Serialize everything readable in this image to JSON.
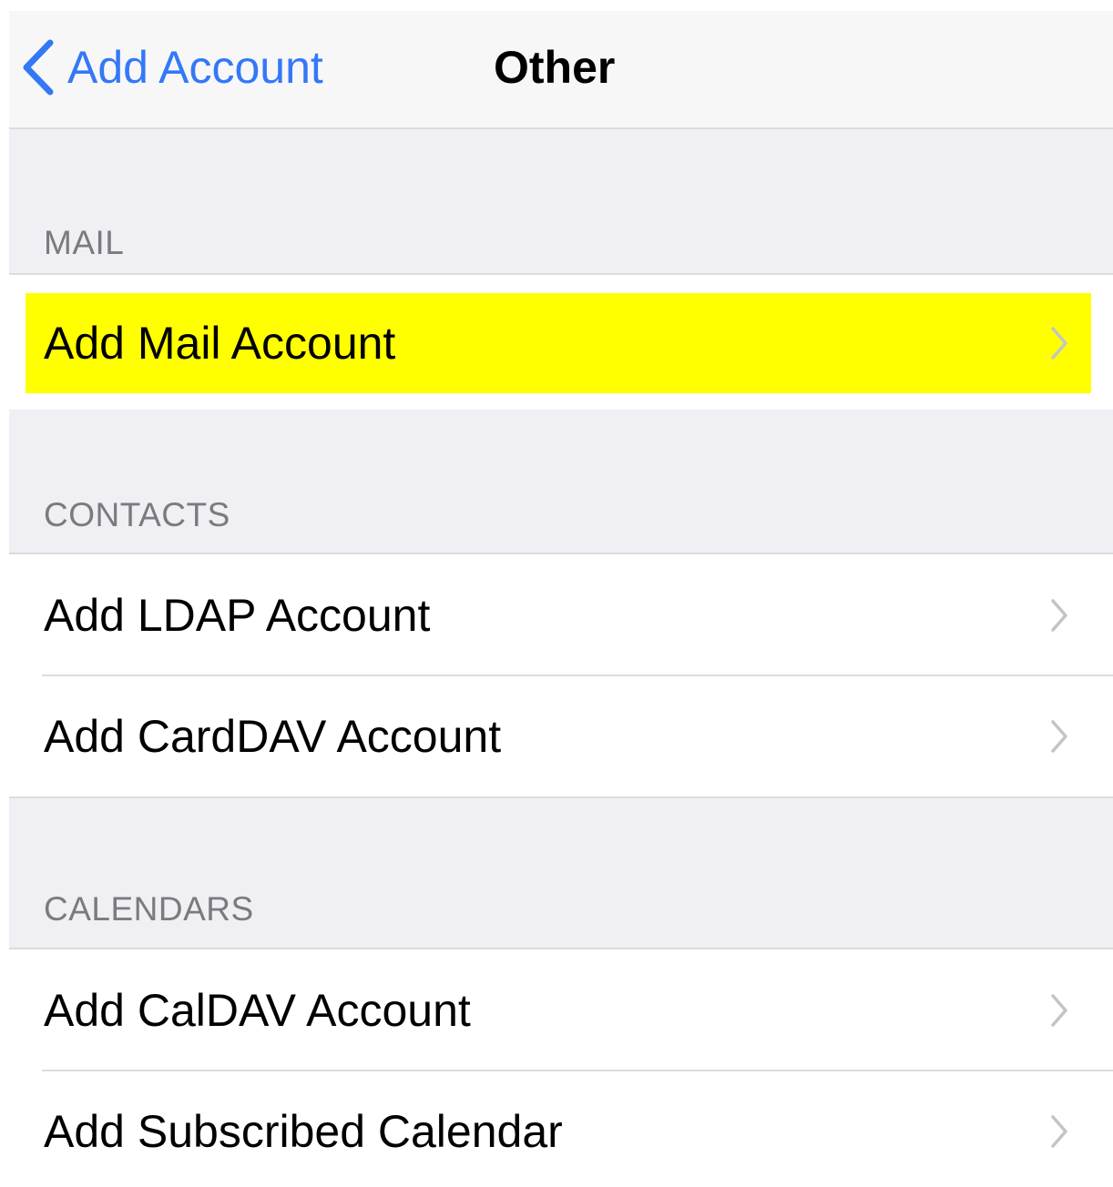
{
  "navbar": {
    "back_label": "Add Account",
    "title": "Other"
  },
  "sections": {
    "mail": {
      "header": "MAIL",
      "items": [
        {
          "label": "Add Mail Account",
          "highlighted": true
        }
      ]
    },
    "contacts": {
      "header": "CONTACTS",
      "items": [
        {
          "label": "Add LDAP Account"
        },
        {
          "label": "Add CardDAV Account"
        }
      ]
    },
    "calendars": {
      "header": "CALENDARS",
      "items": [
        {
          "label": "Add CalDAV Account"
        },
        {
          "label": "Add Subscribed Calendar"
        }
      ]
    }
  },
  "colors": {
    "accent": "#3478f6",
    "highlight": "#ffff00",
    "background": "#efeff4",
    "header_text": "#7a7a7f"
  },
  "icons": {
    "back": "chevron-left-icon",
    "disclosure": "chevron-right-icon"
  }
}
